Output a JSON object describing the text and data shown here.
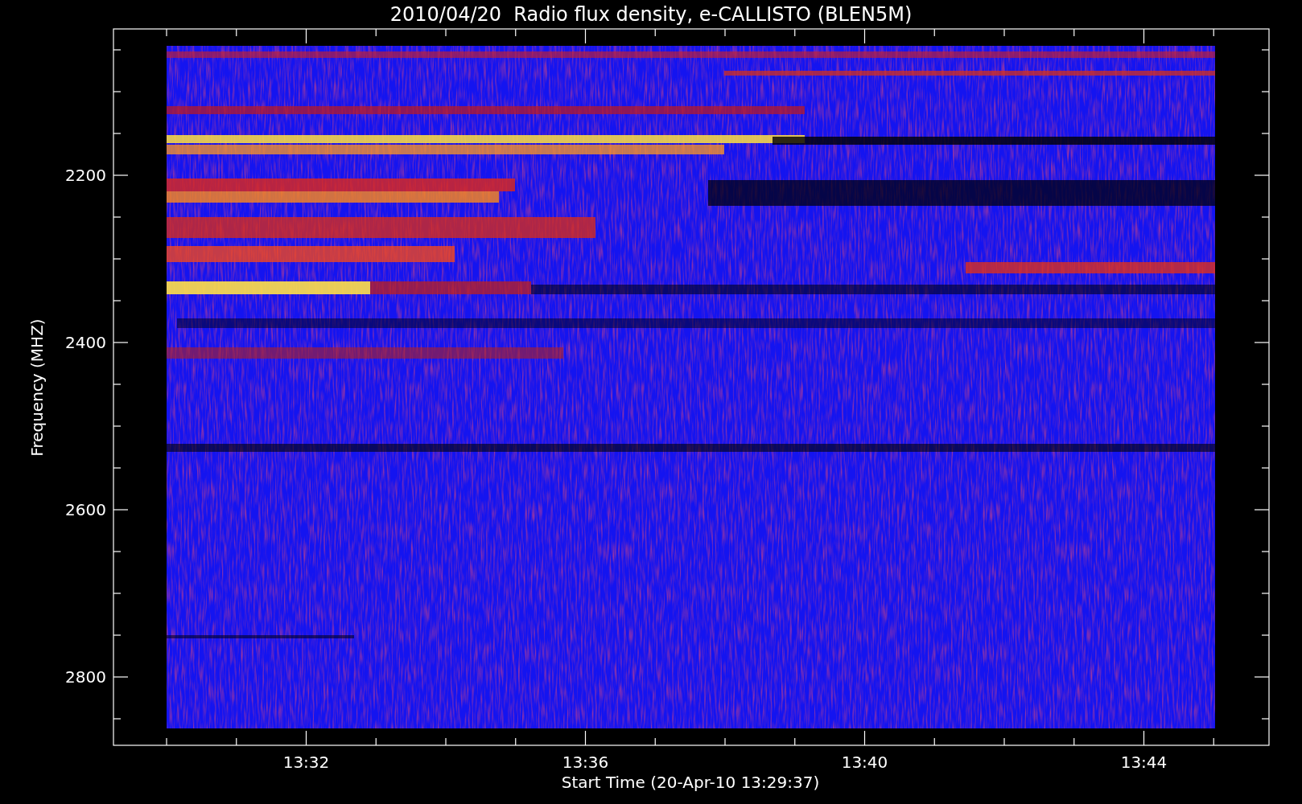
{
  "title": "2010/04/20  Radio flux density, e-CALLISTO (BLEN5M)",
  "x_axis": {
    "label": "Start Time (20-Apr-10 13:29:37)",
    "ticks": [
      "13:32",
      "13:36",
      "13:40",
      "13:44"
    ]
  },
  "y_axis": {
    "label": "Frequency (MHZ)",
    "ticks": [
      "2200",
      "2400",
      "2600",
      "2800"
    ]
  }
}
